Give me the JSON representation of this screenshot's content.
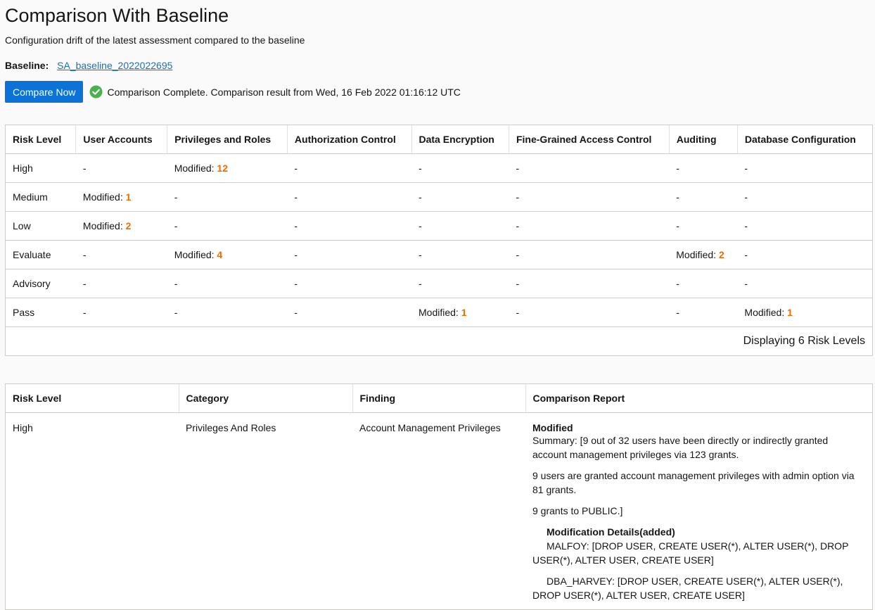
{
  "page": {
    "title": "Comparison With Baseline",
    "subtitle": "Configuration drift of the latest assessment compared to the baseline",
    "baseline_label": "Baseline:",
    "baseline_value": "SA_baseline_2022022695",
    "compare_button": "Compare Now",
    "status_text": "Comparison Complete. Comparison result from Wed, 16 Feb 2022 01:16:12 UTC",
    "status_color": "#4caf50",
    "accent_color": "#0b73d8",
    "highlight_color": "#ef6c00"
  },
  "summary": {
    "headers": [
      "Risk Level",
      "User Accounts",
      "Privileges and Roles",
      "Authorization Control",
      "Data Encryption",
      "Fine-Grained Access Control",
      "Auditing",
      "Database Configuration"
    ],
    "rows": [
      {
        "level": "High",
        "cells": [
          "-",
          "Modified: |12",
          "-",
          "-",
          "-",
          "-",
          "-"
        ]
      },
      {
        "level": "Medium",
        "cells": [
          "Modified: |1",
          "-",
          "-",
          "-",
          "-",
          "-",
          "-"
        ]
      },
      {
        "level": "Low",
        "cells": [
          "Modified: |2",
          "-",
          "-",
          "-",
          "-",
          "-",
          "-"
        ]
      },
      {
        "level": "Evaluate",
        "cells": [
          "-",
          "Modified: |4",
          "-",
          "-",
          "-",
          "Modified: |2",
          "-"
        ]
      },
      {
        "level": "Advisory",
        "cells": [
          "-",
          "-",
          "-",
          "-",
          "-",
          "-",
          "-"
        ]
      },
      {
        "level": "Pass",
        "cells": [
          "-",
          "-",
          "-",
          "Modified: |1",
          "-",
          "-",
          "Modified: |1"
        ]
      }
    ],
    "footer": "Displaying 6 Risk Levels"
  },
  "details": {
    "headers": [
      "Risk Level",
      "Category",
      "Finding",
      "Comparison Report"
    ],
    "row": {
      "risk": "High",
      "category": "Privileges And Roles",
      "finding": "Account Management Privileges",
      "report_title": "Modified",
      "summary_line": "Summary: [9 out of 32 users have been directly or indirectly granted account management privileges via 123 grants.",
      "line2": " 9 users are granted account management privileges with admin option via 81 grants.",
      "line3": " 9 grants to PUBLIC.]",
      "mod_heading": "Modification Details(added)",
      "mod1": "MALFOY: [DROP USER, CREATE USER(*), ALTER USER(*), DROP USER(*), ALTER USER, CREATE USER]",
      "mod2": "DBA_HARVEY: [DROP USER, CREATE USER(*), ALTER USER(*), DROP USER(*), ALTER USER, CREATE USER]"
    }
  }
}
